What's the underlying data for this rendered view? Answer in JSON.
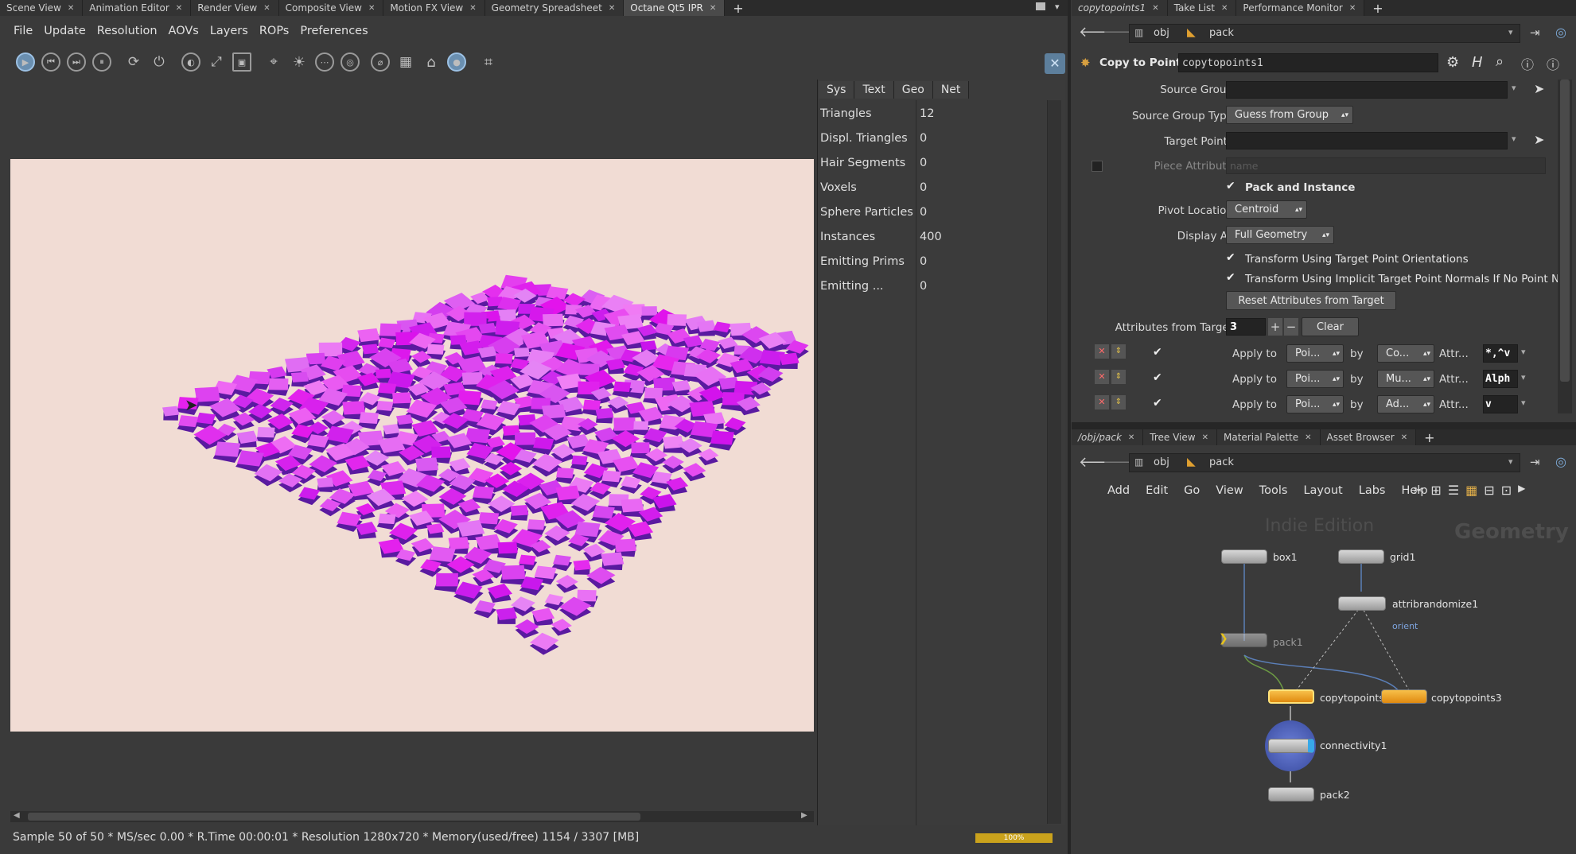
{
  "left_tabs": [
    {
      "label": "Scene View",
      "active": false
    },
    {
      "label": "Animation Editor",
      "active": false
    },
    {
      "label": "Render View",
      "active": false
    },
    {
      "label": "Composite View",
      "active": false
    },
    {
      "label": "Motion FX View",
      "active": false
    },
    {
      "label": "Geometry Spreadsheet",
      "active": false
    },
    {
      "label": "Octane Qt5 IPR",
      "active": true
    }
  ],
  "left_menu": [
    "File",
    "Update",
    "Resolution",
    "AOVs",
    "Layers",
    "ROPs",
    "Preferences"
  ],
  "info_tabs": [
    "Sys",
    "Text",
    "Geo",
    "Net"
  ],
  "stats": [
    {
      "label": "Triangles",
      "value": "12"
    },
    {
      "label": "Displ. Triangles",
      "value": "0"
    },
    {
      "label": "Hair Segments",
      "value": "0"
    },
    {
      "label": "Voxels",
      "value": "0"
    },
    {
      "label": "Sphere Particles",
      "value": "0"
    },
    {
      "label": "Instances",
      "value": "400"
    },
    {
      "label": "Emitting Prims",
      "value": "0"
    },
    {
      "label": "Emitting ...",
      "value": "0"
    }
  ],
  "status_text": "Sample 50 of 50 * MS/sec 0.00 * R.Time 00:00:01 * Resolution 1280x720 * Memory(used/free) 1154 / 3307 [MB]",
  "progress": {
    "label": "100%",
    "value": 1.0
  },
  "right_top_tabs": [
    {
      "label": "copytopoints1",
      "italic": true
    },
    {
      "label": "Take List",
      "italic": false
    },
    {
      "label": "Performance Monitor",
      "italic": false
    }
  ],
  "path": {
    "obj": "obj",
    "node": "pack"
  },
  "params": {
    "node_type": "Copy to Points",
    "node_name": "copytopoints1",
    "source_group_label": "Source Group",
    "source_group_type_label": "Source Group Type",
    "source_group_type_value": "Guess from Group",
    "target_points_label": "Target Points",
    "piece_attribute_label": "Piece Attribute",
    "piece_attribute_placeholder": "name",
    "pack_and_instance": "Pack and Instance",
    "pivot_location_label": "Pivot Location",
    "pivot_location_value": "Centroid",
    "display_as_label": "Display As",
    "display_as_value": "Full Geometry",
    "transform_orient": "Transform Using Target Point Orientations",
    "transform_normals": "Transform Using Implicit Target Point Normals If No Point N...",
    "reset_button": "Reset Attributes from Target",
    "attrs_from_target_label": "Attributes from Target",
    "attrs_count": "3",
    "clear_button": "Clear",
    "attr_rows": [
      {
        "apply_to": "Apply to",
        "target": "Poi...",
        "by": "by",
        "method": "Co...",
        "attr": "Attr...",
        "value": "*,^v"
      },
      {
        "apply_to": "Apply to",
        "target": "Poi...",
        "by": "by",
        "method": "Mu...",
        "attr": "Attr...",
        "value": "Alph"
      },
      {
        "apply_to": "Apply to",
        "target": "Poi...",
        "by": "by",
        "method": "Ad...",
        "attr": "Attr...",
        "value": "v"
      }
    ]
  },
  "right_bottom_tabs": [
    {
      "label": "/obj/pack",
      "italic": true
    },
    {
      "label": "Tree View",
      "italic": false
    },
    {
      "label": "Material Palette",
      "italic": false
    },
    {
      "label": "Asset Browser",
      "italic": false
    }
  ],
  "network_menu": [
    "Add",
    "Edit",
    "Go",
    "View",
    "Tools",
    "Layout",
    "Labs",
    "Help"
  ],
  "network": {
    "watermark_edition": "Indie Edition",
    "watermark_context": "Geometry",
    "nodes": [
      "box1",
      "grid1",
      "attribrandomize1",
      "pack1",
      "copytopoints",
      "copytopoints3",
      "connectivity1",
      "pack2"
    ],
    "orient_label": "orient"
  },
  "colors": {
    "viewport_bg": "#f1dcd4",
    "cube_magenta": "#d63cf2",
    "cube_dark": "#5a1aa0",
    "node_orange": "#f2a81c",
    "node_blue": "#4a78d0"
  }
}
